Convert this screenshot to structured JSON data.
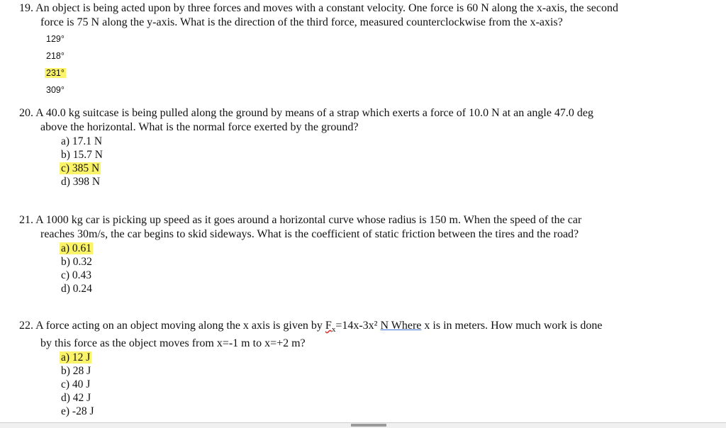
{
  "questions": [
    {
      "number": "19.",
      "line1": "An object is being acted upon by three forces and moves with a constant velocity.  One force is 60 N along the x-axis, the second",
      "line2": "force is 75 N along the y-axis.  What is the direction of the third force, measured counterclockwise from the x-axis?",
      "options": [
        "129°",
        "218°",
        "231°",
        "309°"
      ],
      "highlighted": 2
    },
    {
      "number": "20.",
      "line1": "A 40.0 kg suitcase is being pulled along the ground by means of a strap which exerts a force of 10.0 N at an angle 47.0 deg",
      "line2": "above the horizontal.  What is the normal force exerted by the ground?",
      "options": [
        "a)  17.1 N",
        "b)  15.7 N",
        "c)  385 N",
        "d)  398 N"
      ],
      "highlighted": 2
    },
    {
      "number": "21.",
      "line1": "A 1000 kg car is picking up speed as it goes around a horizontal curve whose radius is 150 m.  When the speed of the car",
      "line2": "reaches 30m/s, the car begins to skid sideways.  What is the coefficient of static friction between the tires and the road?",
      "options": [
        "a)  0.61",
        "b)  0.32",
        "c)  0.43",
        "d)  0.24"
      ],
      "highlighted": 0
    },
    {
      "number": "22.",
      "line1_a": "A force acting on an object moving along the x axis is given by ",
      "line1_f": "F",
      "line1_sub": "x",
      "line1_b": "=14x-3x² ",
      "line1_c": "N  Where",
      "line1_d": " x is in meters.  How much work is done",
      "line2": "by this force as the object moves from x=-1 m to x=+2 m?",
      "options": [
        "a)  12 J",
        "b)  28 J",
        "c)  40 J",
        "d)  42 J",
        "e)  -28 J"
      ],
      "highlighted": 0
    }
  ],
  "highlight_color": "#fbf36a"
}
